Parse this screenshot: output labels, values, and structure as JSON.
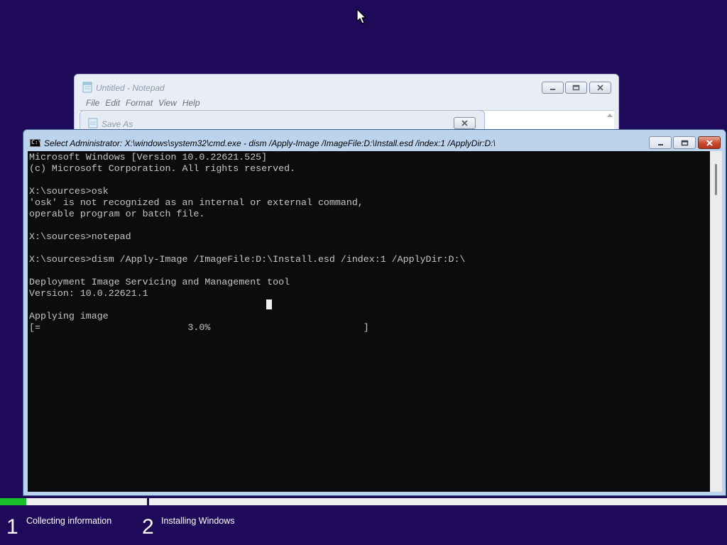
{
  "notepad": {
    "title": "Untitled - Notepad",
    "menu": [
      "File",
      "Edit",
      "Format",
      "View",
      "Help"
    ],
    "icon": "notepad-icon"
  },
  "save_dialog": {
    "title": "Save As",
    "icon": "save-dialog-icon"
  },
  "cmd": {
    "title": "Select Administrator: X:\\windows\\system32\\cmd.exe - dism  /Apply-Image /ImageFile:D:\\Install.esd /index:1 /ApplyDir:D:\\",
    "icon_label": "C:\\",
    "lines": [
      "Microsoft Windows [Version 10.0.22621.525]",
      "(c) Microsoft Corporation. All rights reserved.",
      "",
      "X:\\sources>osk",
      "'osk' is not recognized as an internal or external command,",
      "operable program or batch file.",
      "",
      "X:\\sources>notepad",
      "",
      "X:\\sources>dism /Apply-Image /ImageFile:D:\\Install.esd /index:1 /ApplyDir:D:\\",
      "",
      "Deployment Image Servicing and Management tool",
      "Version: 10.0.22621.1",
      "",
      "Applying image",
      "[=                          3.0%                           ]"
    ]
  },
  "setup": {
    "steps": [
      {
        "number": "1",
        "label": "Collecting information"
      },
      {
        "number": "2",
        "label": "Installing Windows"
      }
    ],
    "step1_progress_fraction": 0.18,
    "accent_color": "#19c22a",
    "background_color": "#1f0a5a"
  }
}
